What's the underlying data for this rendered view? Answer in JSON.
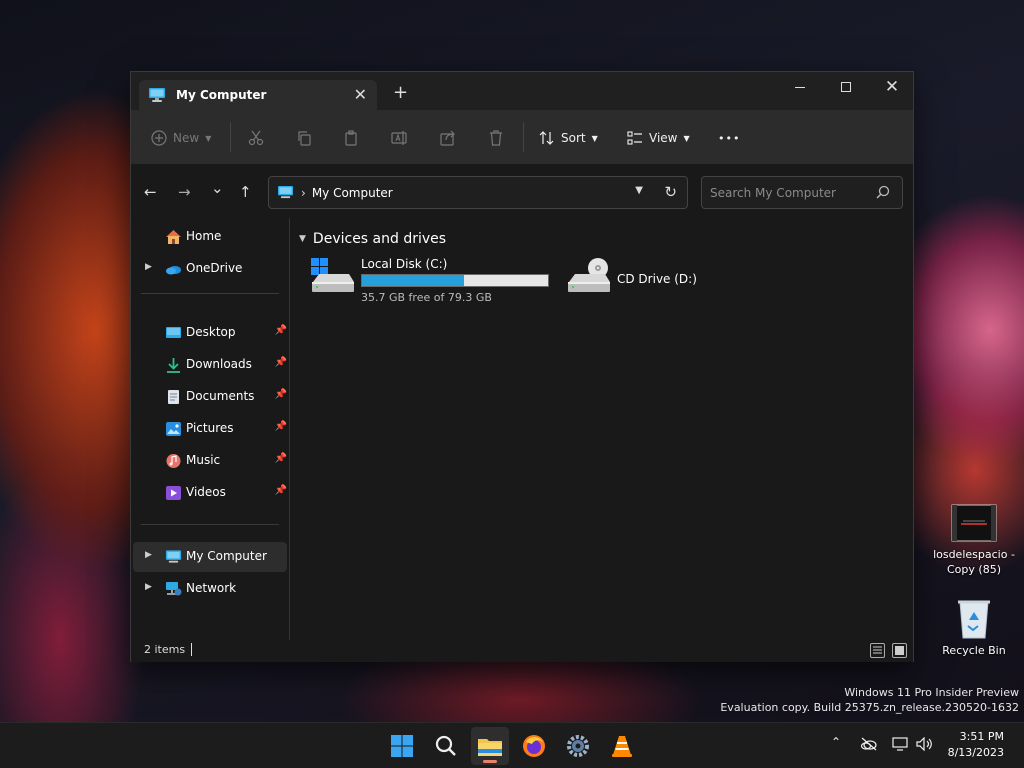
{
  "window": {
    "tab_title": "My Computer",
    "close_tab": "✕",
    "new_tab": "+",
    "controls": {
      "close": "✕"
    }
  },
  "toolbar": {
    "new_label": "New",
    "sort_label": "Sort",
    "view_label": "View",
    "more_label": "•••"
  },
  "navigation": {
    "back": "←",
    "forward": "→",
    "recent": "⌄",
    "up": "↑",
    "address_location": "My Computer",
    "address_sep": "›",
    "search_placeholder": "Search My Computer"
  },
  "sidebar": {
    "items": [
      {
        "label": "Home",
        "icon": "home-icon"
      },
      {
        "label": "OneDrive",
        "icon": "cloud-icon"
      },
      {
        "label": "Desktop",
        "icon": "desktop-icon"
      },
      {
        "label": "Downloads",
        "icon": "download-icon"
      },
      {
        "label": "Documents",
        "icon": "document-icon"
      },
      {
        "label": "Pictures",
        "icon": "picture-icon"
      },
      {
        "label": "Music",
        "icon": "music-icon"
      },
      {
        "label": "Videos",
        "icon": "video-icon"
      },
      {
        "label": "My Computer",
        "icon": "computer-icon",
        "selected": true
      },
      {
        "label": "Network",
        "icon": "network-icon"
      }
    ]
  },
  "content": {
    "group_title": "Devices and drives",
    "drives": [
      {
        "name": "Local Disk (C:)",
        "free": "35.7 GB free of 79.3 GB",
        "used_fraction": 0.55,
        "icon": "hard-drive-icon"
      },
      {
        "name": "CD Drive (D:)",
        "icon": "cd-drive-icon"
      }
    ]
  },
  "statusbar": {
    "items_count": "2 items"
  },
  "desktop": {
    "icons": [
      {
        "label": "losdelespacio - Copy (85)",
        "icon": "video-file-icon"
      },
      {
        "label": "Recycle Bin",
        "icon": "recycle-bin-icon"
      }
    ],
    "watermark_line1": "Windows 11 Pro Insider Preview",
    "watermark_line2": "Evaluation copy. Build 25375.zn_release.230520-1632"
  },
  "taskbar": {
    "time": "3:51 PM",
    "date": "8/13/2023",
    "apps": [
      "start-icon",
      "search-icon",
      "file-explorer-icon",
      "firefox-icon",
      "settings-icon",
      "vlc-icon"
    ]
  },
  "colors": {
    "accent": "#26a0da",
    "window_bg": "#191919",
    "toolbar_bg": "#2c2c2c",
    "taskbar_bg": "#1c1c1c"
  }
}
